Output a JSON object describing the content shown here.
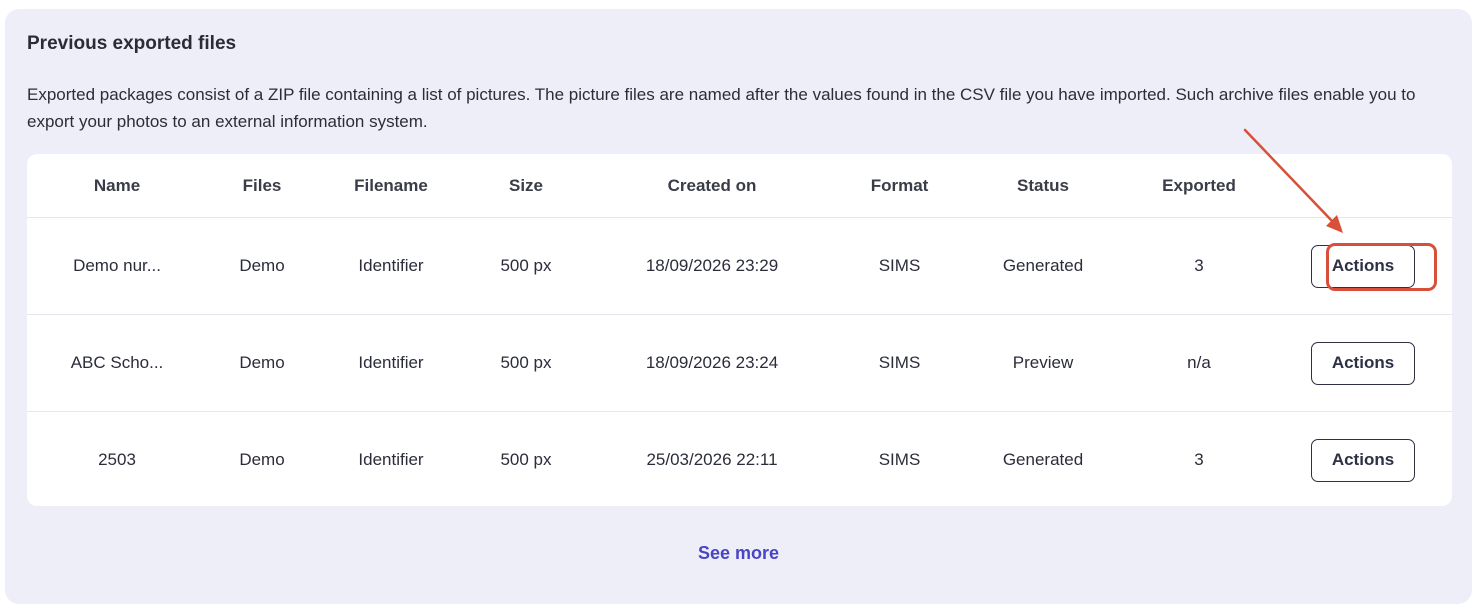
{
  "section": {
    "title": "Previous exported files",
    "description": "Exported packages consist of a ZIP file containing a list of pictures. The picture files are named after the values found in the CSV file you have imported. Such archive files enable you to export your photos to an external information system."
  },
  "table": {
    "headers": {
      "name": "Name",
      "files": "Files",
      "filename": "Filename",
      "size": "Size",
      "created_on": "Created on",
      "format": "Format",
      "status": "Status",
      "exported": "Exported"
    },
    "rows": [
      {
        "name": "Demo nur...",
        "files": "Demo",
        "filename": "Identifier",
        "size": "500 px",
        "created_on": "18/09/2026 23:29",
        "format": "SIMS",
        "status": "Generated",
        "exported": "3",
        "action_label": "Actions"
      },
      {
        "name": "ABC Scho...",
        "files": "Demo",
        "filename": "Identifier",
        "size": "500 px",
        "created_on": "18/09/2026 23:24",
        "format": "SIMS",
        "status": "Preview",
        "exported": "n/a",
        "action_label": "Actions"
      },
      {
        "name": "2503",
        "files": "Demo",
        "filename": "Identifier",
        "size": "500 px",
        "created_on": "25/03/2026 22:11",
        "format": "SIMS",
        "status": "Generated",
        "exported": "3",
        "action_label": "Actions"
      }
    ]
  },
  "see_more_label": "See more",
  "colors": {
    "panel_bg": "#eeeef8",
    "card_bg": "#ffffff",
    "link": "#4a44c6",
    "annotation": "#d9503a",
    "button_border": "#2e3046"
  },
  "annotation": {
    "type": "arrow-and-box",
    "target": "first-row-actions-button"
  }
}
